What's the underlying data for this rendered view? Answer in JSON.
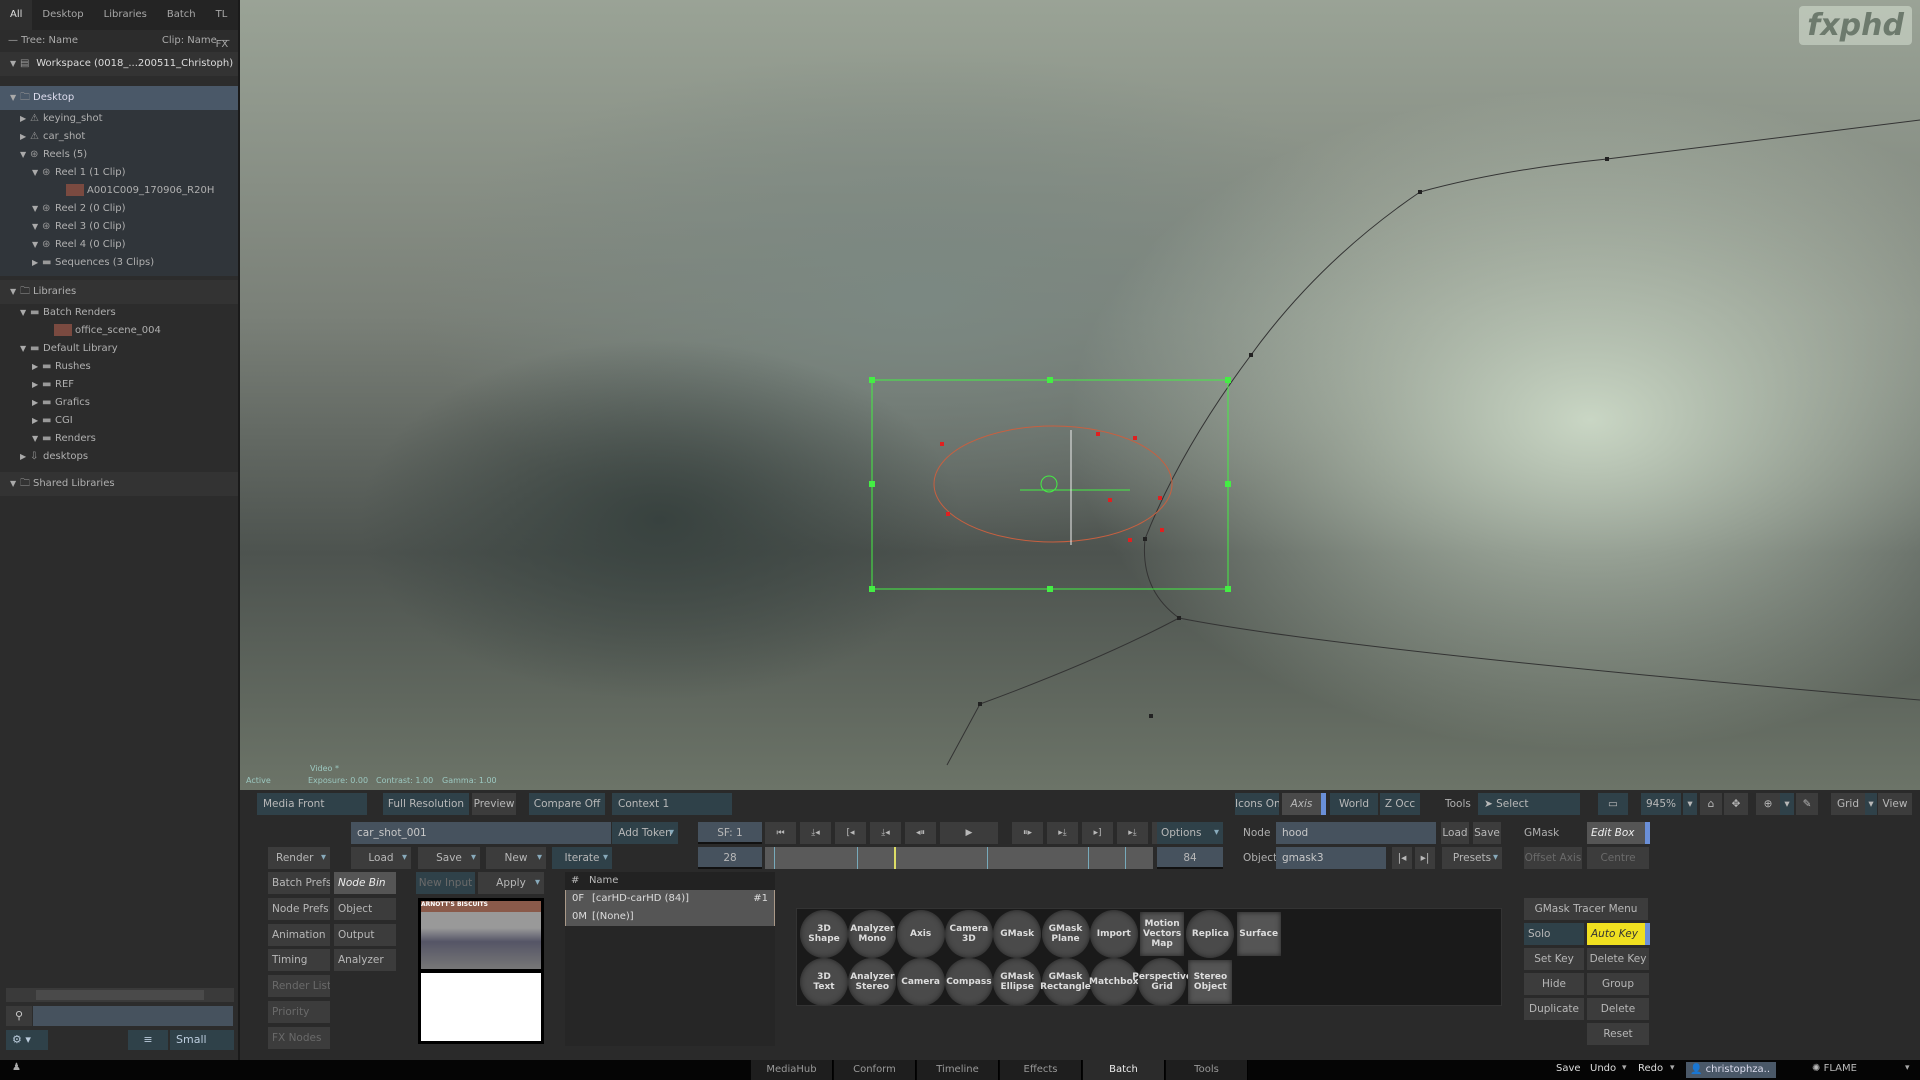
{
  "left_panel": {
    "tabs": [
      "All",
      "Desktop",
      "Libraries",
      "Batch",
      "TL FX"
    ],
    "tree_header": "— Tree: Name",
    "clip_header": "Clip: Name —",
    "workspace": "Workspace (0018_...200511_Christoph)",
    "desktop": "Desktop",
    "items": [
      {
        "label": "keying_shot",
        "indent": 1,
        "tri": "▶",
        "icon": "batch-group-icon"
      },
      {
        "label": "car_shot",
        "indent": 1,
        "tri": "▶",
        "icon": "batch-group-icon"
      },
      {
        "label": "Reels (5)",
        "indent": 1,
        "tri": "▼",
        "icon": "reels-icon"
      },
      {
        "label": "Reel 1 (1 Clip)",
        "indent": 2,
        "tri": "▼",
        "icon": "reel-icon"
      },
      {
        "label": "A001C009_170906_R20H",
        "indent": 4,
        "tri": "",
        "icon": "clip-thumbnail-icon"
      },
      {
        "label": "Reel 2 (0 Clip)",
        "indent": 2,
        "tri": "▼",
        "icon": "reel-icon"
      },
      {
        "label": "Reel 3 (0 Clip)",
        "indent": 2,
        "tri": "▼",
        "icon": "reel-icon"
      },
      {
        "label": "Reel 4 (0 Clip)",
        "indent": 2,
        "tri": "▼",
        "icon": "reel-icon"
      },
      {
        "label": "Sequences (3 Clips)",
        "indent": 2,
        "tri": "▶",
        "icon": "sequence-icon"
      }
    ],
    "libraries": "Libraries",
    "lib_items": [
      {
        "label": "Batch Renders",
        "indent": 1,
        "tri": "▼",
        "icon": "library-icon"
      },
      {
        "label": "office_scene_004",
        "indent": 3,
        "tri": "",
        "icon": "clip-thumbnail-icon"
      },
      {
        "label": "Default Library",
        "indent": 1,
        "tri": "▼",
        "icon": "library-icon"
      },
      {
        "label": "Rushes",
        "indent": 2,
        "tri": "▶",
        "icon": "folder-icon"
      },
      {
        "label": "REF",
        "indent": 2,
        "tri": "▶",
        "icon": "folder-icon"
      },
      {
        "label": "Grafics",
        "indent": 2,
        "tri": "▶",
        "icon": "folder-icon"
      },
      {
        "label": "CGI",
        "indent": 2,
        "tri": "▶",
        "icon": "folder-icon"
      },
      {
        "label": "Renders",
        "indent": 2,
        "tri": "▼",
        "icon": "folder-open-icon"
      },
      {
        "label": "desktops",
        "indent": 1,
        "tri": "▶",
        "icon": "download-folder-icon"
      }
    ],
    "shared": "Shared Libraries",
    "size_label": "Small"
  },
  "viewer": {
    "logo": "fxphd",
    "overlay": {
      "video": "Video *",
      "active": "Active",
      "exposure": "Exposure: 0.00",
      "contrast": "Contrast: 1.00",
      "gamma": "Gamma: 1.00"
    }
  },
  "toolbar": {
    "media_front": "Media Front",
    "full_res": "Full Resolution",
    "preview": "Preview",
    "compare": "Compare Off",
    "context": "Context 1",
    "icons_on": "Icons On",
    "axis": "Axis",
    "world": "World",
    "zocc": "Z Occ",
    "tools": "Tools",
    "select": "Select",
    "zoom": "945%",
    "grid": "Grid",
    "view": "View"
  },
  "batch": {
    "name_value": "car_shot_001",
    "add_token": "Add Token",
    "render": "Render",
    "load": "Load",
    "save": "Save",
    "new": "New",
    "iterate": "Iterate",
    "start_frame": "SF: 1",
    "current_frame": "28",
    "end_frame": "84",
    "options": "Options",
    "transport_icons": [
      "go-to-start-icon",
      "prev-keyframe-icon",
      "go-to-in-icon",
      "prev-marker-icon",
      "step-back-icon",
      "play-icon",
      "step-forward-icon",
      "next-marker-icon",
      "go-to-out-icon",
      "next-keyframe-icon",
      "go-to-end-icon"
    ],
    "transport_glyphs": [
      "⏮",
      "⤓◂",
      "[◂",
      "⤓◂",
      "◂⏸",
      "▶",
      "⏸▸",
      "▸⤓",
      "▸]",
      "▸⤓",
      "⏭"
    ],
    "left_col": [
      "Batch Prefs",
      "Node Prefs",
      "Animation",
      "Timing",
      "Render List",
      "Priority",
      "FX Nodes"
    ],
    "right_col": [
      "Node Bin",
      "Object",
      "Output",
      "Analyzer"
    ],
    "new_input": "New Input",
    "apply": "Apply",
    "list_header": {
      "num": "#",
      "name": "Name"
    },
    "list_rows": [
      {
        "num": "0F",
        "name": "[carHD-carHD (84)]",
        "tag": "#1"
      },
      {
        "num": "0M",
        "name": "[(None)]",
        "tag": ""
      }
    ],
    "thumbnail_sign": "ARNOTT'S BISCUITS"
  },
  "node": {
    "node_label": "Node",
    "node_value": "hood",
    "load": "Load",
    "save": "Save",
    "gmask_label": "GMask",
    "edit_box": "Edit Box",
    "object_label": "Object",
    "object_value": "gmask3",
    "presets": "Presets",
    "offset_axis": "Offset Axis",
    "centre": "Centre"
  },
  "node_bin": {
    "row1": [
      {
        "l": "3D\nShape"
      },
      {
        "l": "Analyzer\nMono"
      },
      {
        "l": "Axis"
      },
      {
        "l": "Camera\n3D"
      },
      {
        "l": "GMask"
      },
      {
        "l": "GMask\nPlane"
      },
      {
        "l": "Import"
      },
      {
        "l": "Motion\nVectors\nMap",
        "sq": true
      },
      {
        "l": "Replica"
      },
      {
        "l": "Surface",
        "sq": true
      }
    ],
    "row2": [
      {
        "l": "3D\nText"
      },
      {
        "l": "Analyzer\nStereo"
      },
      {
        "l": "Camera"
      },
      {
        "l": "Compass"
      },
      {
        "l": "GMask\nEllipse"
      },
      {
        "l": "GMask\nRectangle"
      },
      {
        "l": "Matchbox"
      },
      {
        "l": "Perspective\nGrid"
      },
      {
        "l": "Stereo\nObject",
        "sq": true
      }
    ]
  },
  "tracer": {
    "menu": "GMask Tracer Menu",
    "solo": "Solo",
    "auto_key": "Auto Key",
    "set_key": "Set Key",
    "delete_key": "Delete Key",
    "hide": "Hide",
    "group": "Group",
    "duplicate": "Duplicate",
    "delete": "Delete",
    "reset": "Reset",
    "auto_key_color": "#f0e020"
  },
  "bottom": {
    "tabs": [
      "MediaHub",
      "Conform",
      "Timeline",
      "Effects",
      "Batch",
      "Tools"
    ],
    "active_tab": "Batch",
    "save": "Save",
    "undo": "Undo",
    "redo": "Redo",
    "user": "christophza..",
    "app": "FLAME"
  },
  "colors": {
    "accent": "#6a8fd8",
    "panel": "#2c2c2c",
    "mask_box": "#44ee44",
    "keyframe": "#e02020"
  }
}
